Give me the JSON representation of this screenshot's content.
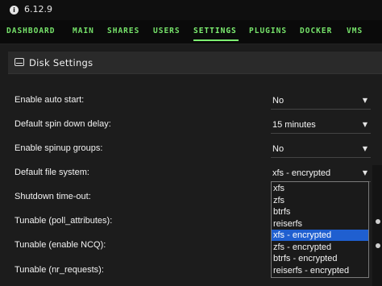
{
  "topbar": {
    "version": "6.12.9"
  },
  "nav": {
    "items": [
      "DASHBOARD",
      "MAIN",
      "SHARES",
      "USERS",
      "SETTINGS",
      "PLUGINS",
      "DOCKER",
      "VMS"
    ],
    "active": "SETTINGS"
  },
  "section": {
    "title": "Disk Settings"
  },
  "settings": {
    "auto_start": {
      "label": "Enable auto start:",
      "value": "No"
    },
    "spin_down": {
      "label": "Default spin down delay:",
      "value": "15 minutes"
    },
    "spinup_groups": {
      "label": "Enable spinup groups:",
      "value": "No"
    },
    "file_system": {
      "label": "Default file system:",
      "value": "xfs - encrypted",
      "options": [
        "xfs",
        "zfs",
        "btrfs",
        "reiserfs",
        "xfs - encrypted",
        "zfs - encrypted",
        "btrfs - encrypted",
        "reiserfs - encrypted"
      ],
      "selected_index": 4
    },
    "shutdown_timeout": {
      "label": "Shutdown time-out:"
    },
    "poll_attributes": {
      "label": "Tunable (poll_attributes):"
    },
    "enable_ncq": {
      "label": "Tunable (enable NCQ):"
    },
    "nr_requests": {
      "label": "Tunable (nr_requests):"
    }
  },
  "colors": {
    "nav_green": "#76e36a",
    "selected_option": "#1f5fd0",
    "background": "#1c1c1c"
  }
}
